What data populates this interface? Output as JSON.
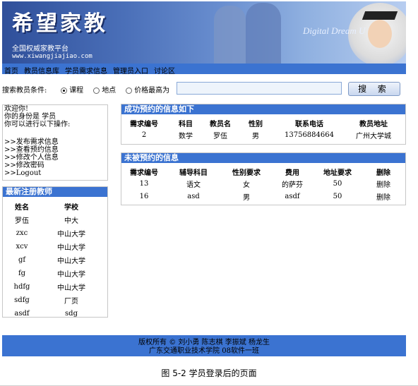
{
  "banner": {
    "logo": "希望家教",
    "slogan": "全国权威家教平台",
    "url": "www.xiwangjiajiao.com",
    "brand": "Digital Dream U"
  },
  "nav": [
    "首页",
    "教员信息库",
    "学员需求信息",
    "管理员入口",
    "讨论区"
  ],
  "search": {
    "label": "搜索教员条件:",
    "options": [
      {
        "label": "课程",
        "selected": true
      },
      {
        "label": "地点",
        "selected": false
      },
      {
        "label": "价格最高为",
        "selected": false
      }
    ],
    "value": "",
    "button": "搜 索"
  },
  "welcome": {
    "line1": "欢迎你!",
    "line2": "你的身份是 学员",
    "line3": "你可以进行以下操作:",
    "actions": [
      ">>发布需求信息",
      ">>查看预约信息",
      ">>修改个人信息",
      ">>修改密码",
      ">>Logout"
    ]
  },
  "teachers": {
    "title": "最新注册教师",
    "headers": [
      "姓名",
      "学校"
    ],
    "rows": [
      [
        "罗伍",
        "中大"
      ],
      [
        "zxc",
        "中山大学"
      ],
      [
        "xcv",
        "中山大学"
      ],
      [
        "gf",
        "中山大学"
      ],
      [
        "fg",
        "中山大学"
      ],
      [
        "hdfg",
        "中山大学"
      ],
      [
        "sdfg",
        "厂页"
      ],
      [
        "asdf",
        "sdg"
      ]
    ]
  },
  "booked": {
    "title": "成功预约的信息如下",
    "headers": [
      "需求编号",
      "科目",
      "教员名",
      "性别",
      "联系电话",
      "教员地址"
    ],
    "rows": [
      [
        "2",
        "数学",
        "罗伍",
        "男",
        "13756884664",
        "广州大学城"
      ]
    ]
  },
  "unbooked": {
    "title": "未被预约的信息",
    "headers": [
      "需求编号",
      "辅导科目",
      "性别要求",
      "费用",
      "地址要求",
      "删除"
    ],
    "rows": [
      [
        "13",
        "语文",
        "女",
        "的萨芬",
        "50",
        "删除"
      ],
      [
        "16",
        "asd",
        "男",
        "asdf",
        "50",
        "删除"
      ]
    ]
  },
  "footer": {
    "line1": "版权所有 © 刘小勇 陈志棋 李振斌 杨龙生",
    "line2": "广东交通职业技术学院 08软件一班"
  },
  "caption": "图 5-2 学员登录后的页面",
  "colors": {
    "accent_blue": "#3b73d1",
    "border_gray": "#c7c7c7"
  }
}
